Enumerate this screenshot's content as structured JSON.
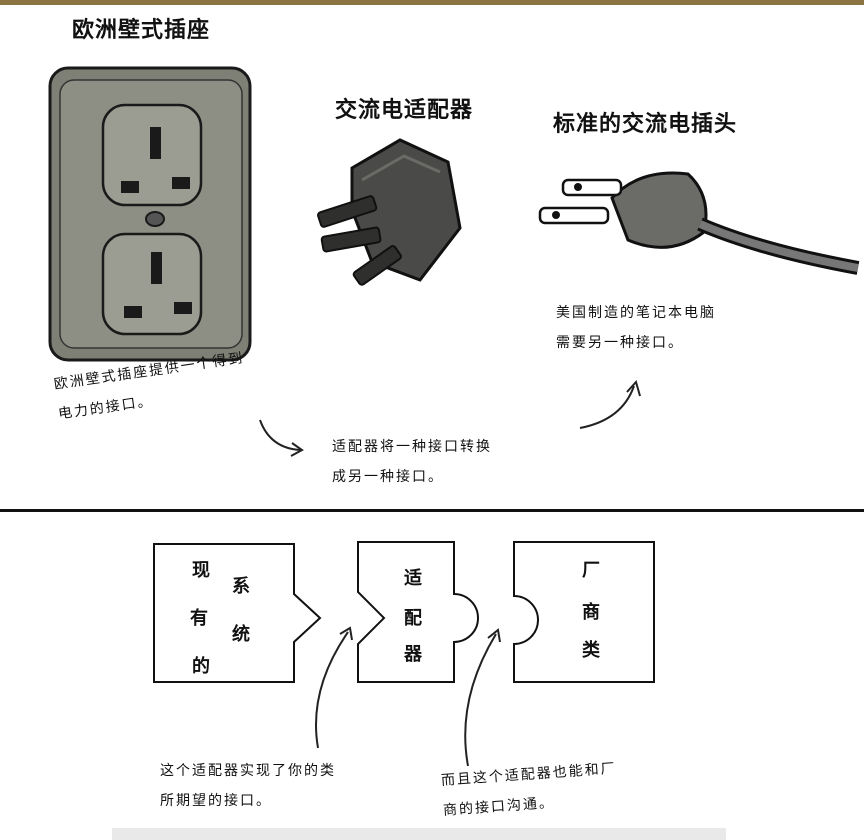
{
  "top": {
    "euro_outlet_title": "欧洲壁式插座",
    "adapter_title": "交流电适配器",
    "plug_title": "标准的交流电插头",
    "euro_outlet_note": [
      "欧洲壁式插座提供一个得到",
      "电力的接口。"
    ],
    "adapter_note": [
      "适配器将一种接口转换",
      "成另一种接口。"
    ],
    "plug_note": [
      "美国制造的笔记本电脑",
      "需要另一种接口。"
    ]
  },
  "bottom": {
    "existing_system_label": [
      "现",
      "有",
      "的",
      "系",
      "统"
    ],
    "adapter_label": [
      "适",
      "配",
      "器"
    ],
    "vendor_class_label": [
      "厂",
      "商",
      "类"
    ],
    "adapter_note_left": [
      "这个适配器实现了你的类",
      "所期望的接口。"
    ],
    "adapter_note_right": [
      "而且这个适配器也能和厂",
      "商的接口沟通。"
    ]
  }
}
